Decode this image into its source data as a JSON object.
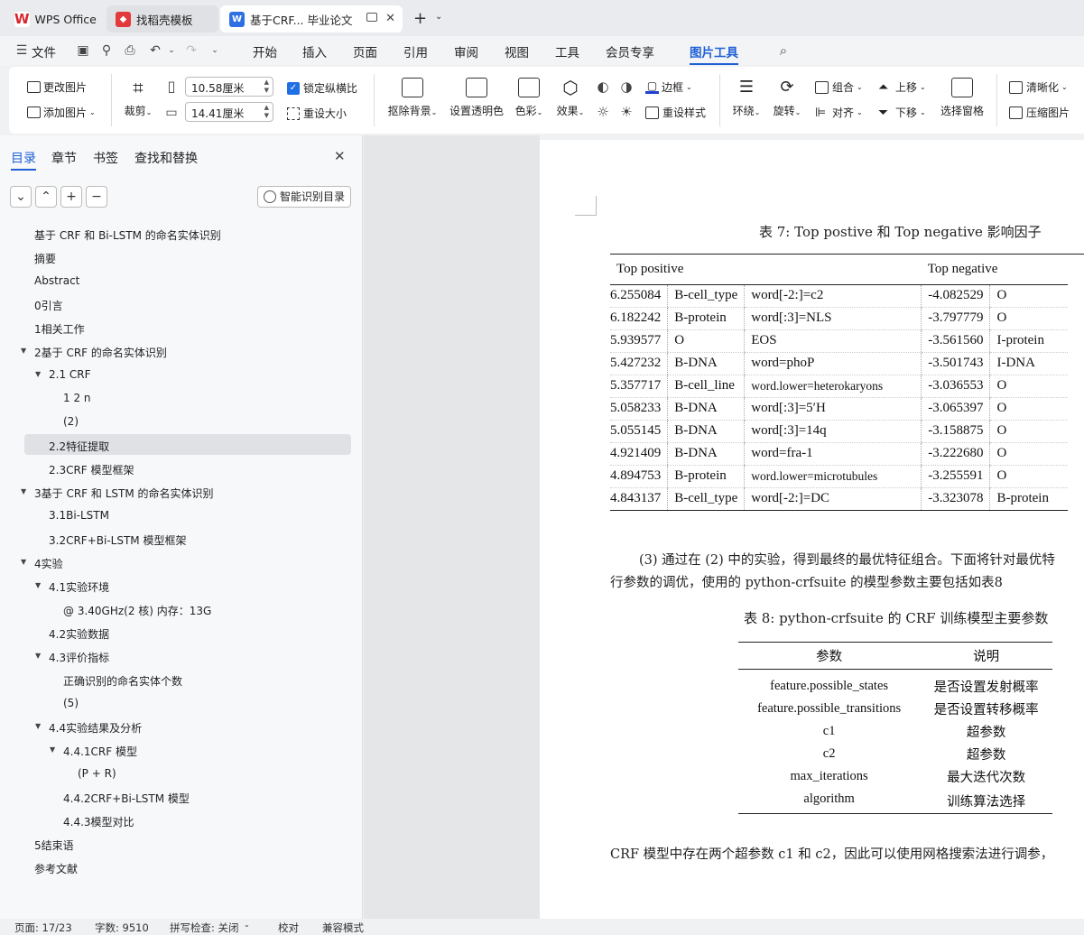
{
  "tabs": [
    {
      "label": "WPS Office"
    },
    {
      "label": "找稻壳模板"
    },
    {
      "label": "基于CRF... 毕业论文"
    }
  ],
  "menu": {
    "file": "文件",
    "items": [
      "开始",
      "插入",
      "页面",
      "引用",
      "审阅",
      "视图",
      "工具",
      "会员专享",
      "图片工具"
    ]
  },
  "ribbon": {
    "change_picture": "更改图片",
    "add_picture": "添加图片",
    "crop": "裁剪",
    "width_value": "10.58厘米",
    "height_value": "14.41厘米",
    "lock_ratio": "锁定纵横比",
    "reset_size": "重设大小",
    "remove_bg": "抠除背景",
    "set_transparent": "设置透明色",
    "color": "色彩",
    "effect": "效果",
    "border": "边框",
    "reset_style": "重设样式",
    "wrap": "环绕",
    "rotate": "旋转",
    "group": "组合",
    "align": "对齐",
    "move_up": "上移",
    "move_down": "下移",
    "selection_pane": "选择窗格",
    "sharpen": "清晰化",
    "compress": "压缩图片"
  },
  "sidebar": {
    "tabs": [
      "目录",
      "章节",
      "书签",
      "查找和替换"
    ],
    "smart_toc": "智能识别目录",
    "toc": [
      "基于 CRF 和 Bi-LSTM 的命名实体识别",
      "摘要",
      "Abstract",
      "0引言",
      "1相关工作",
      "2基于 CRF 的命名实体识别",
      "2.1  CRF",
      "1  2   n",
      "(2)",
      "2.2特征提取",
      "2.3CRF 模型框架",
      "3基于 CRF 和 LSTM 的命名实体识别",
      "3.1Bi-LSTM",
      "3.2CRF+Bi-LSTM 模型框架",
      "4实验",
      "4.1实验环境",
      "@ 3.40GHz(2 核) 内存：13G",
      "4.2实验数据",
      "4.3评价指标",
      "正确识别的命名实体个数",
      "(5)",
      "4.4实验结果及分析",
      "4.4.1CRF 模型",
      "(P + R)",
      "4.4.2CRF+Bi-LSTM 模型",
      "4.4.3模型对比",
      "5结束语",
      "参考文献"
    ]
  },
  "document": {
    "table7_caption": "表  7: Top postive 和  Top negative 影响因子",
    "table7_header": {
      "positive": "Top positive",
      "negative": "Top negative"
    },
    "table7_rows": [
      [
        "6.255084",
        "B-cell_type",
        "word[-2:]=c2",
        "-4.082529",
        "O"
      ],
      [
        "6.182242",
        "B-protein",
        "word[:3]=NLS",
        "-3.797779",
        "O"
      ],
      [
        "5.939577",
        "O",
        "EOS",
        "-3.561560",
        "I-protein"
      ],
      [
        "5.427232",
        "B-DNA",
        "word=phoP",
        "-3.501743",
        "I-DNA"
      ],
      [
        "5.357717",
        "B-cell_line",
        "word.lower=heterokaryons",
        "-3.036553",
        "O"
      ],
      [
        "5.058233",
        "B-DNA",
        "word[:3]=5′H",
        "-3.065397",
        "O"
      ],
      [
        "5.055145",
        "B-DNA",
        "word[:3]=14q",
        "-3.158875",
        "O"
      ],
      [
        "4.921409",
        "B-DNA",
        "word=fra-1",
        "-3.222680",
        "O"
      ],
      [
        "4.894753",
        "B-protein",
        "word.lower=microtubules",
        "-3.255591",
        "O"
      ],
      [
        "4.843137",
        "B-cell_type",
        "word[-2:]=DC",
        "-3.323078",
        "B-protein"
      ]
    ],
    "para1_line1": "(3)  通过在  (2) 中的实验，得到最终的最优特征组合。下面将针对最优特",
    "para1_line2": "行参数的调优，使用的  python-crfsuite 的模型参数主要包括如表8",
    "table8_caption": "表  8: python-crfsuite 的  CRF 训练模型主要参数",
    "table8_header": [
      "参数",
      "说明"
    ],
    "table8_rows": [
      [
        "feature.possible_states",
        "是否设置发射概率"
      ],
      [
        "feature.possible_transitions",
        "是否设置转移概率"
      ],
      [
        "c1",
        "超参数"
      ],
      [
        "c2",
        "超参数"
      ],
      [
        "max_iterations",
        "最大迭代次数"
      ],
      [
        "algorithm",
        "训练算法选择"
      ]
    ],
    "para2": "CRF 模型中存在两个超参数  c1 和  c2，因此可以使用网格搜索法进行调参，"
  },
  "status": {
    "page": "页面: 17/23",
    "words": "字数: 9510",
    "spell": "拼写检查: 关闭",
    "proof": "校对",
    "compat": "兼容模式"
  }
}
